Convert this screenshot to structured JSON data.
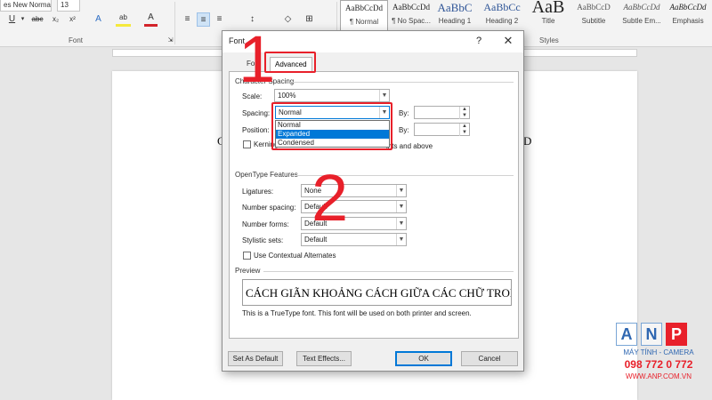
{
  "ribbon": {
    "font_name": "es New Normal",
    "font_size": "13",
    "font_group_label": "Font",
    "styles_group_label": "Styles",
    "formatting_glyphs": [
      "U",
      "abc",
      "x₂",
      "x²",
      "A",
      "ab",
      "A"
    ],
    "style_gallery": [
      {
        "sample": "AaBbCcDd",
        "name": "¶ Normal"
      },
      {
        "sample": "AaBbCcDd",
        "name": "¶ No Spac..."
      },
      {
        "sample": "AaBbC",
        "name": "Heading 1"
      },
      {
        "sample": "AaBbCc",
        "name": "Heading 2"
      },
      {
        "sample": "AaB",
        "name": "Title"
      },
      {
        "sample": "AaBbCcD",
        "name": "Subtitle"
      },
      {
        "sample": "AaBbCcDd",
        "name": "Subtle Em..."
      },
      {
        "sample": "AaBbCcDd",
        "name": "Emphasis"
      }
    ]
  },
  "document": {
    "left_fragment": "C",
    "right_fragment": "D"
  },
  "dialog": {
    "title": "Font",
    "help_glyph": "?",
    "close_glyph": "✕",
    "tabs": [
      "Font",
      "Advanced"
    ],
    "character_spacing": {
      "heading": "Character Spacing",
      "scale_label": "Scale:",
      "scale_value": "100%",
      "spacing_label": "Spacing:",
      "spacing_value": "Normal",
      "spacing_options": [
        "Normal",
        "Expanded",
        "Condensed"
      ],
      "spacing_highlighted": "Expanded",
      "by_label": "By:",
      "position_label": "Position:",
      "position_by_label": "By:",
      "kerning_label": "Kerning",
      "kerning_suffix": "ints and above"
    },
    "opentype": {
      "heading": "OpenType Features",
      "ligatures_label": "Ligatures:",
      "ligatures_value": "None",
      "number_spacing_label": "Number spacing:",
      "number_spacing_value": "Default",
      "number_forms_label": "Number forms:",
      "number_forms_value": "Default",
      "stylistic_sets_label": "Stylistic sets:",
      "stylistic_sets_value": "Default",
      "contextual_label": "Use Contextual Alternates"
    },
    "preview": {
      "heading": "Preview",
      "sample": "CÁCH GIÃN KHOẢNG CÁCH GIỮA CÁC CHỮ TRONG",
      "note": "This is a TrueType font. This font will be used on both printer and screen."
    },
    "buttons": {
      "set_default": "Set As Default",
      "text_effects": "Text Effects...",
      "ok": "OK",
      "cancel": "Cancel"
    }
  },
  "annotations": {
    "step1": "1",
    "step2": "2",
    "color": "#e8202a"
  },
  "watermark": {
    "letters": [
      "A",
      "N",
      "P"
    ],
    "tagline": "MÁY TÍNH - CAMERA",
    "phone": "098 772 0 772",
    "site": "WWW.ANP.COM.VN"
  }
}
